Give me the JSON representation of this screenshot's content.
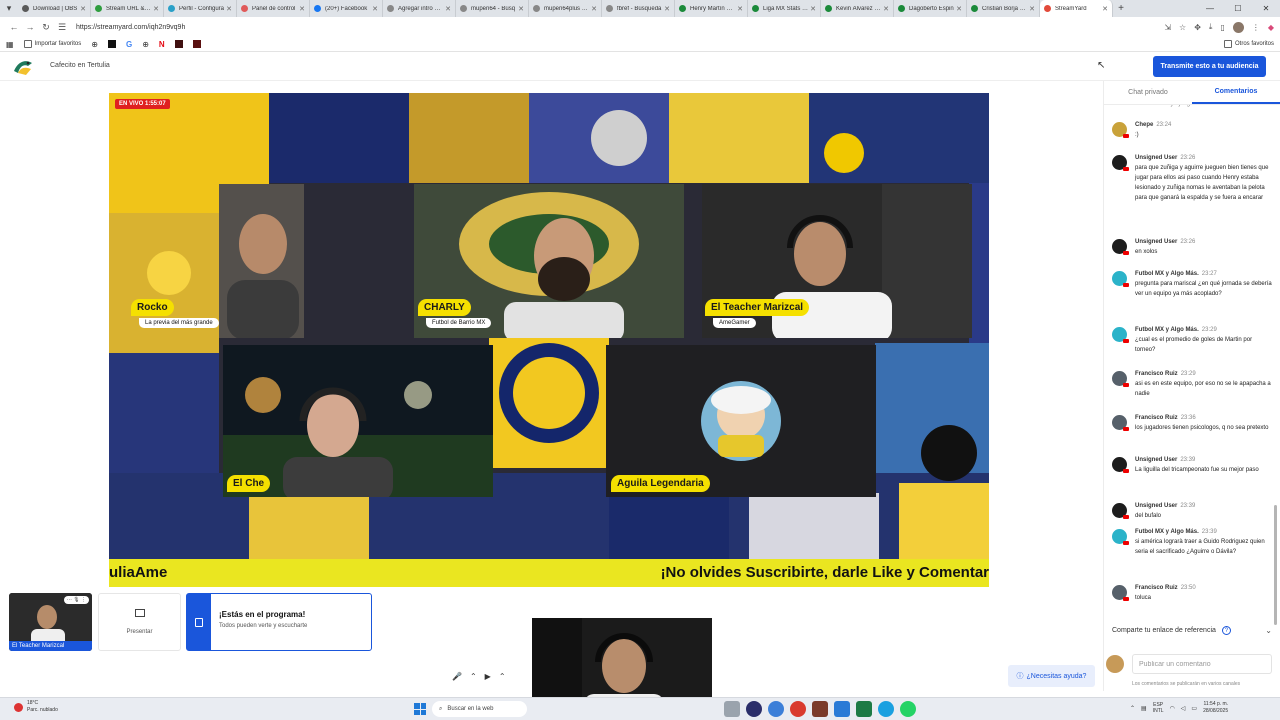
{
  "browser": {
    "tabs": [
      {
        "label": "Download | OBS",
        "color": "#5a5a5a",
        "active": false
      },
      {
        "label": "Stream URL & Ke",
        "color": "#2e9d3f",
        "active": false
      },
      {
        "label": "Perfil - Configura",
        "color": "#2aa0c8",
        "active": false
      },
      {
        "label": "Panel de control",
        "color": "#e05a5a",
        "active": false
      },
      {
        "label": "(20+) Facebook",
        "color": "#1877f2",
        "active": false
      },
      {
        "label": "Agregar intro a C",
        "color": "#888888",
        "active": false
      },
      {
        "label": "mupen64 - Búsq",
        "color": "#888888",
        "active": false
      },
      {
        "label": "mupen64plus - E",
        "color": "#888888",
        "active": false
      },
      {
        "label": "fbref - Búsqueda",
        "color": "#888888",
        "active": false
      },
      {
        "label": "Henry Martín Sta",
        "color": "#1b8a3a",
        "active": false
      },
      {
        "label": "Liga MX Stats | Fi",
        "color": "#1b8a3a",
        "active": false
      },
      {
        "label": "Kevin Álvarez Sta",
        "color": "#1b8a3a",
        "active": false
      },
      {
        "label": "Dagoberto Espin",
        "color": "#1b8a3a",
        "active": false
      },
      {
        "label": "Cristian Borja Sta",
        "color": "#1b8a3a",
        "active": false
      },
      {
        "label": "StreamYard",
        "color": "#e24a3a",
        "active": true
      }
    ],
    "url": "https://streamyard.com/iqh2n9vq9h",
    "bookmarks_import": "Importar favoritos",
    "bookmarks_other": "Otros favoritos"
  },
  "header": {
    "broadcast_title": "Cafecito en Tertulia",
    "stream_button": "Transmite esto a tu audiencia"
  },
  "stage": {
    "live_badge": "EN VIVO 1:55:07",
    "participants": [
      {
        "name": "Rocko",
        "subtitle": "La previa del más grande"
      },
      {
        "name": "CHARLY",
        "subtitle": "Futbol de Barrio MX"
      },
      {
        "name": "El Teacher Marizcal",
        "subtitle": "AmeGamer"
      },
      {
        "name": "El Che",
        "subtitle": ""
      },
      {
        "name": "Aguila Legendaria",
        "subtitle": ""
      }
    ],
    "ticker_left": "uliaAme",
    "ticker_right": "¡No olvides Suscribirte, darle Like y Comentar"
  },
  "bottom": {
    "self_name": "El Teacher Marizcal",
    "present_label": "Presentar",
    "onair_title": "¡Estás en el programa!",
    "onair_sub": "Todos pueden verte y escucharte",
    "help_label": "¿Necesitas ayuda?"
  },
  "sidebar": {
    "tabs": [
      "Chat privado",
      "Comentarios"
    ],
    "comments": [
      {
        "author": "",
        "time": "",
        "text": "nervios o así ya juego",
        "avatar": "#ffffff"
      },
      {
        "author": "Chepe",
        "time": "23:24",
        "text": ":)",
        "avatar": "#c9a23a"
      },
      {
        "author": "Unsigned User",
        "time": "23:26",
        "text": "para que zuñiga y aguirre jueguen bien tienes que jugar para ellos asi paso cuando Henry estaba lesionado y zuñiga nomas le aventaban la pelota para que ganará la espalda y se fuera a encarar",
        "avatar": "#1d1d1d"
      },
      {
        "author": "Unsigned User",
        "time": "23:26",
        "text": "en xolos",
        "avatar": "#1d1d1d"
      },
      {
        "author": "Futbol MX y Algo Más.",
        "time": "23:27",
        "text": "pregunta para mariscal ¿en qué jornada se debería ver un equipo ya más acoplado?",
        "avatar": "#2bb3c9"
      },
      {
        "author": "Futbol MX y Algo Más.",
        "time": "23:29",
        "text": "¿cual es el promedio de goles de Martin por torneo?",
        "avatar": "#2bb3c9"
      },
      {
        "author": "Francisco Ruiz",
        "time": "23:29",
        "text": "asi es en este equipo, por eso no se le apapacha a nadie",
        "avatar": "#56606a"
      },
      {
        "author": "Francisco Ruiz",
        "time": "23:36",
        "text": "los jugadores tienen psicologos, q no sea pretexto",
        "avatar": "#56606a"
      },
      {
        "author": "Unsigned User",
        "time": "23:39",
        "text": "La liguilla del tricampeonato fue su mejor paso",
        "avatar": "#1d1d1d"
      },
      {
        "author": "Unsigned User",
        "time": "23:39",
        "text": "del bufalo",
        "avatar": "#1d1d1d"
      },
      {
        "author": "Futbol MX y Algo Más.",
        "time": "23:39",
        "text": "si américa lograrà traer a Guido Rodriguez quien seria el sacrificado ¿Aguirre o Dávila?",
        "avatar": "#2bb3c9"
      },
      {
        "author": "Francisco Ruiz",
        "time": "23:50",
        "text": "toluca",
        "avatar": "#56606a"
      }
    ],
    "share_link": "Comparte tu enlace de referencia",
    "comment_placeholder": "Publicar un comentario",
    "disclaimer": "Los comentarios se publicarán en varios canales"
  },
  "taskbar": {
    "temp": "18°C",
    "weather": "Parc. nublado",
    "search_placeholder": "Buscar en la web",
    "lang": "ESP",
    "lang2": "INTL",
    "time": "11:54 p. m.",
    "date": "28/08/2025"
  }
}
